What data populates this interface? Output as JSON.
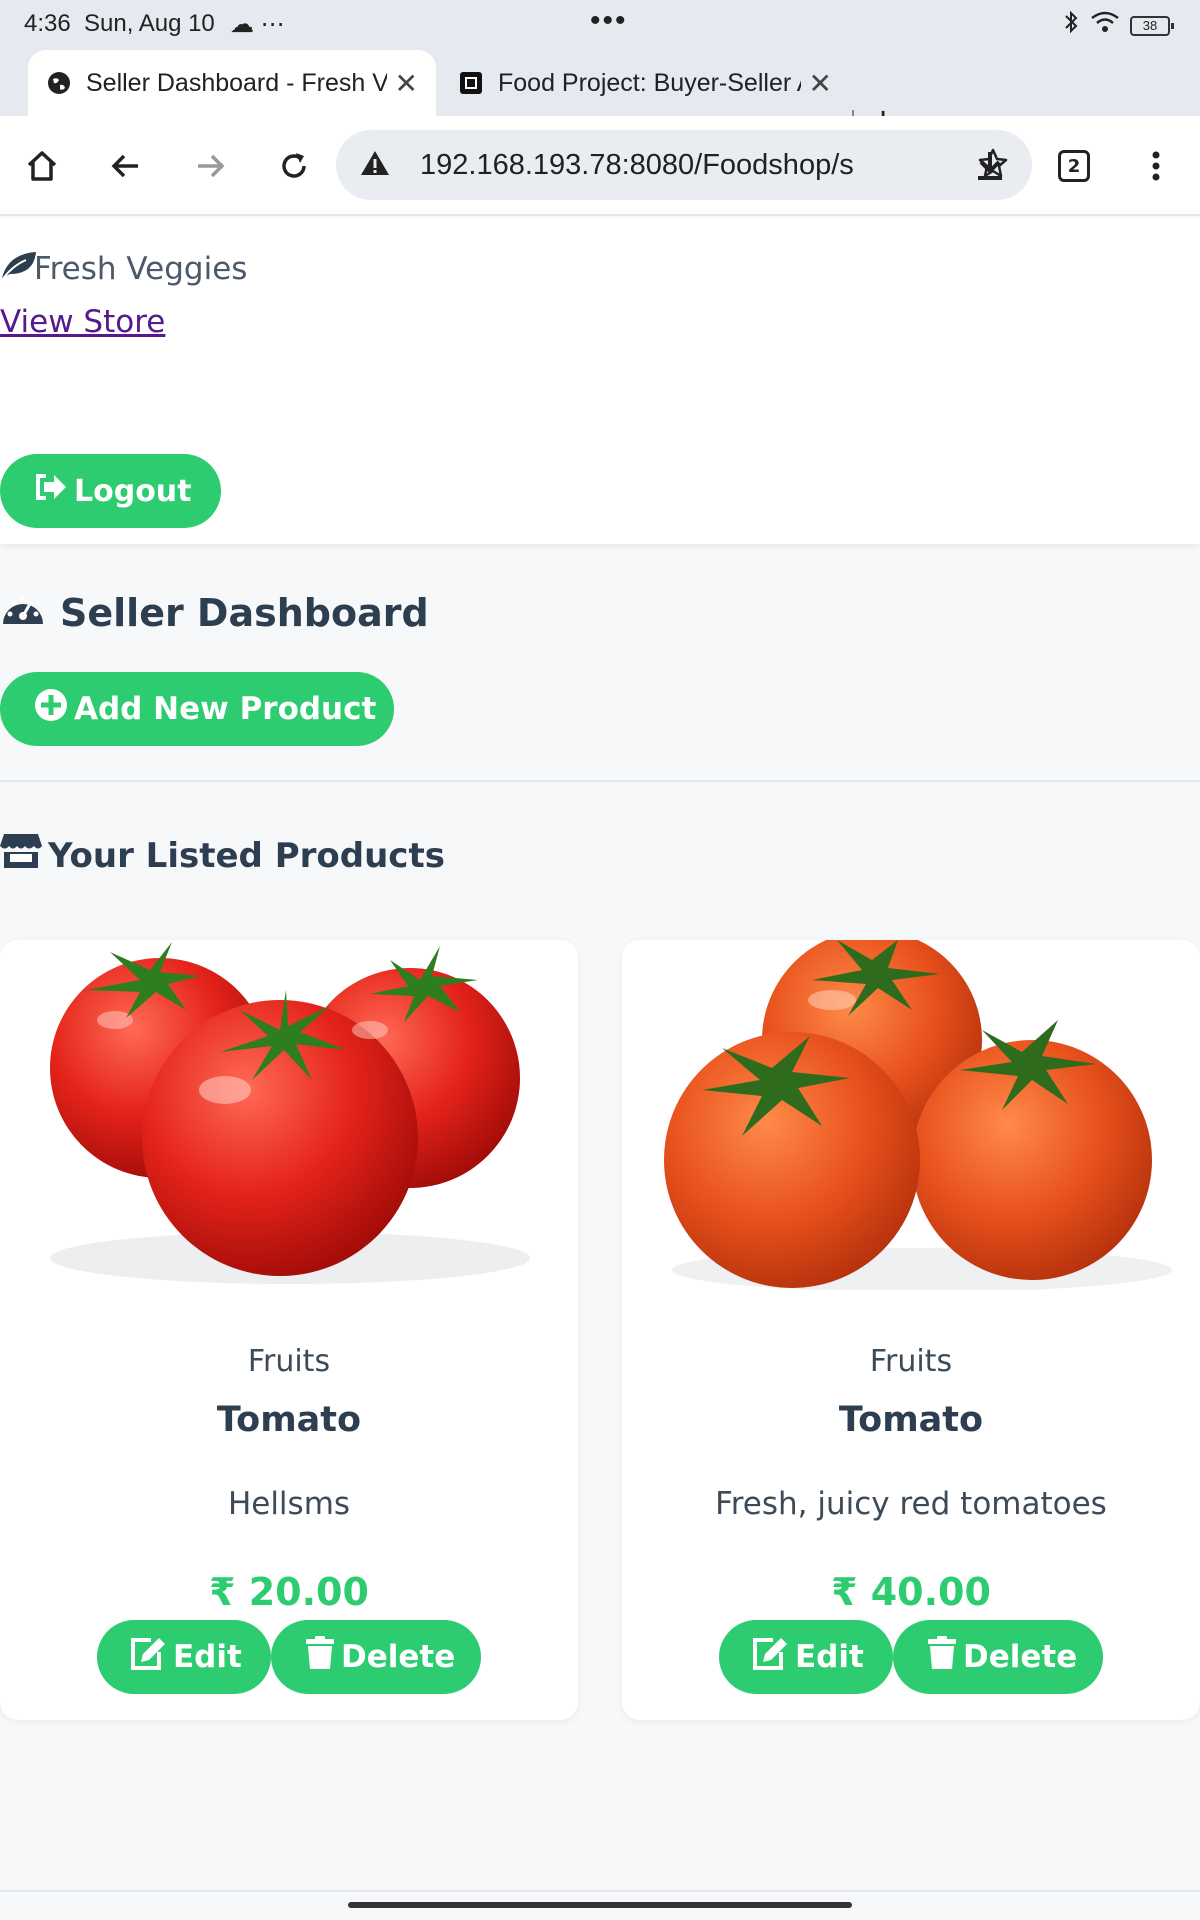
{
  "status_bar": {
    "time": "4:36",
    "date": "Sun, Aug 10",
    "overflow": "•••",
    "battery": "38"
  },
  "browser": {
    "tabs": [
      {
        "title": "Seller Dashboard - Fresh Veg",
        "active": true
      },
      {
        "title": "Food Project: Buyer-Seller Ac",
        "active": false
      }
    ],
    "url": "192.168.193.78:8080/Foodshop/s",
    "tab_count": "2"
  },
  "header": {
    "brand": "Fresh Veggies",
    "view_store": "View Store",
    "logout": "Logout"
  },
  "dashboard": {
    "title": "Seller Dashboard",
    "add_product": "Add New Product",
    "listed_title": "Your Listed Products"
  },
  "products": [
    {
      "category": "Fruits",
      "name": "Tomato",
      "description": "Hellsms",
      "price": "₹ 20.00",
      "edit": "Edit",
      "delete": "Delete"
    },
    {
      "category": "Fruits",
      "name": "Tomato",
      "description": "Fresh, juicy red tomatoes",
      "price": "₹ 40.00",
      "edit": "Edit",
      "delete": "Delete"
    }
  ],
  "colors": {
    "accent": "#2ecc71",
    "text": "#2d3e50",
    "link": "#551a8b",
    "page_bg": "#f6f8fa"
  }
}
